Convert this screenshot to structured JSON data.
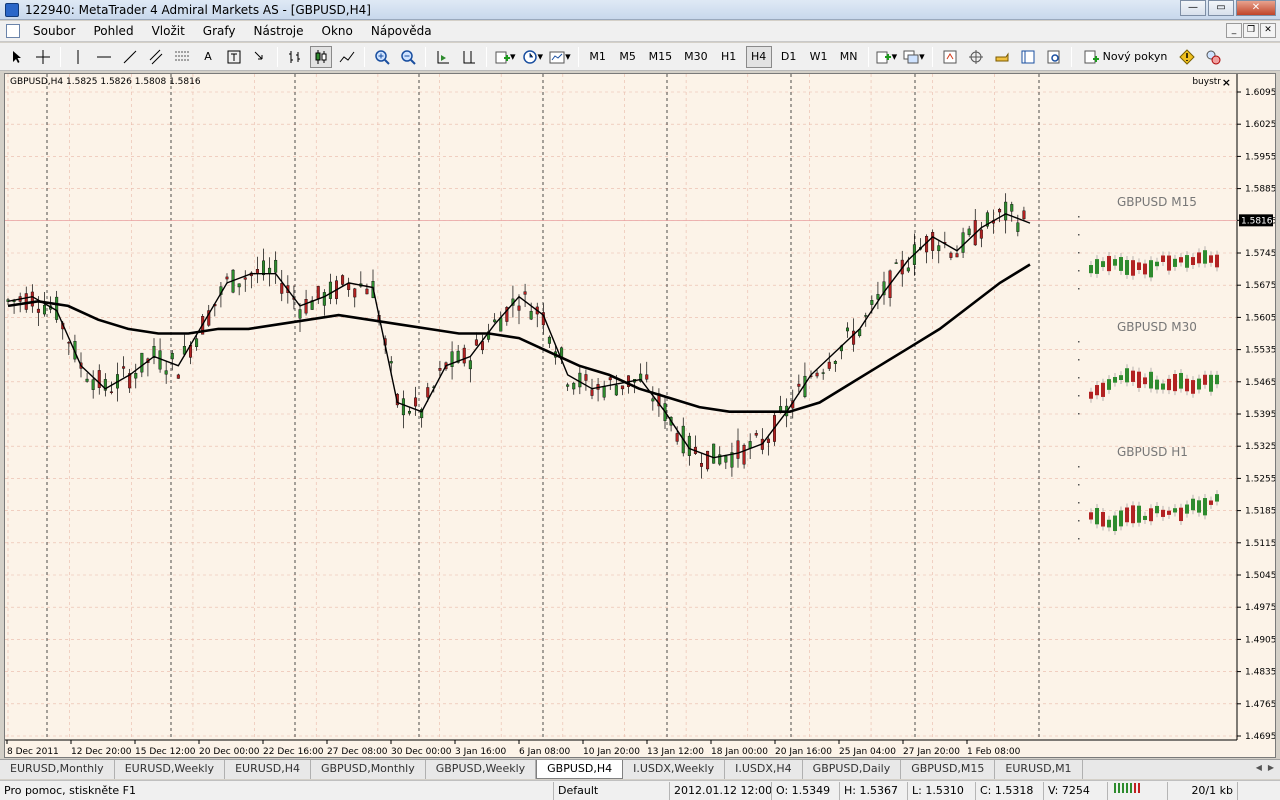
{
  "window": {
    "title": "122940: MetaTrader 4 Admiral Markets AS - [GBPUSD,H4]"
  },
  "menu": [
    "Soubor",
    "Pohled",
    "Vložit",
    "Grafy",
    "Nástroje",
    "Okno",
    "Nápověda"
  ],
  "toolbar": {
    "timeframes": [
      "M1",
      "M5",
      "M15",
      "M30",
      "H1",
      "H4",
      "D1",
      "W1",
      "MN"
    ],
    "active_timeframe": "H4",
    "new_order_label": "Nový pokyn"
  },
  "chart": {
    "info": "GBPUSD,H4  1.5825 1.5826 1.5808 1.5816",
    "indicator_label": "buystr",
    "current_price": "1.5816",
    "price_labels": [
      "1.6095",
      "1.6025",
      "1.5955",
      "1.5885",
      "1.5816",
      "1.5745",
      "1.5675",
      "1.5605",
      "1.5535",
      "1.5465",
      "1.5395",
      "1.5325",
      "1.5255",
      "1.5185",
      "1.5115",
      "1.5045",
      "1.4975",
      "1.4905",
      "1.4835",
      "1.4765",
      "1.4695"
    ],
    "time_labels": [
      "8 Dec 2011",
      "12 Dec 20:00",
      "15 Dec 12:00",
      "20 Dec 00:00",
      "22 Dec 16:00",
      "27 Dec 08:00",
      "30 Dec 00:00",
      "3 Jan 16:00",
      "6 Jan 08:00",
      "10 Jan 20:00",
      "13 Jan 12:00",
      "18 Jan 00:00",
      "20 Jan 16:00",
      "25 Jan 04:00",
      "27 Jan 20:00",
      "1 Feb 08:00"
    ],
    "mini_charts": [
      "GBPUSD M15",
      "GBPUSD M30",
      "GBPUSD H1"
    ],
    "colors": {
      "background": "#fcf3e8",
      "bull": "#2e8b2e",
      "bear": "#b22222",
      "grid": "#e8b8a8",
      "ma": "#000000"
    }
  },
  "chart_data": {
    "type": "line",
    "title": "GBPUSD,H4",
    "ylim": [
      1.4695,
      1.6095
    ],
    "series": [
      {
        "values": [
          1.564,
          1.565,
          1.562,
          1.55,
          1.545,
          1.548,
          1.552,
          1.55,
          1.559,
          1.568,
          1.57,
          1.57,
          1.563,
          1.565,
          1.568,
          1.567,
          1.542,
          1.54,
          1.55,
          1.552,
          1.559,
          1.565,
          1.561,
          1.548,
          1.545,
          1.546,
          1.547,
          1.54,
          1.532,
          1.53,
          1.531,
          1.533,
          1.54,
          1.548,
          1.553,
          1.558,
          1.566,
          1.573,
          1.578,
          1.575,
          1.58,
          1.583,
          1.581
        ]
      },
      {
        "values": [
          1.563,
          1.564,
          1.563,
          1.56,
          1.558,
          1.557,
          1.557,
          1.558,
          1.558,
          1.559,
          1.56,
          1.561,
          1.56,
          1.559,
          1.558,
          1.557,
          1.557,
          1.556,
          1.553,
          1.55,
          1.548,
          1.545,
          1.543,
          1.541,
          1.54,
          1.54,
          1.54,
          1.542,
          1.546,
          1.55,
          1.554,
          1.558,
          1.563,
          1.568,
          1.572
        ]
      }
    ]
  },
  "tabs": [
    "EURUSD,Monthly",
    "EURUSD,Weekly",
    "EURUSD,H4",
    "GBPUSD,Monthly",
    "GBPUSD,Weekly",
    "GBPUSD,H4",
    "I.USDX,Weekly",
    "I.USDX,H4",
    "GBPUSD,Daily",
    "GBPUSD,M15",
    "EURUSD,M1"
  ],
  "active_tab": "GBPUSD,H4",
  "status": {
    "help": "Pro pomoc, stiskněte F1",
    "profile": "Default",
    "datetime": "2012.01.12 12:00",
    "open": "O: 1.5349",
    "high": "H: 1.5367",
    "low": "L: 1.5310",
    "close": "C: 1.5318",
    "volume": "V: 7254",
    "traffic": "20/1 kb"
  }
}
